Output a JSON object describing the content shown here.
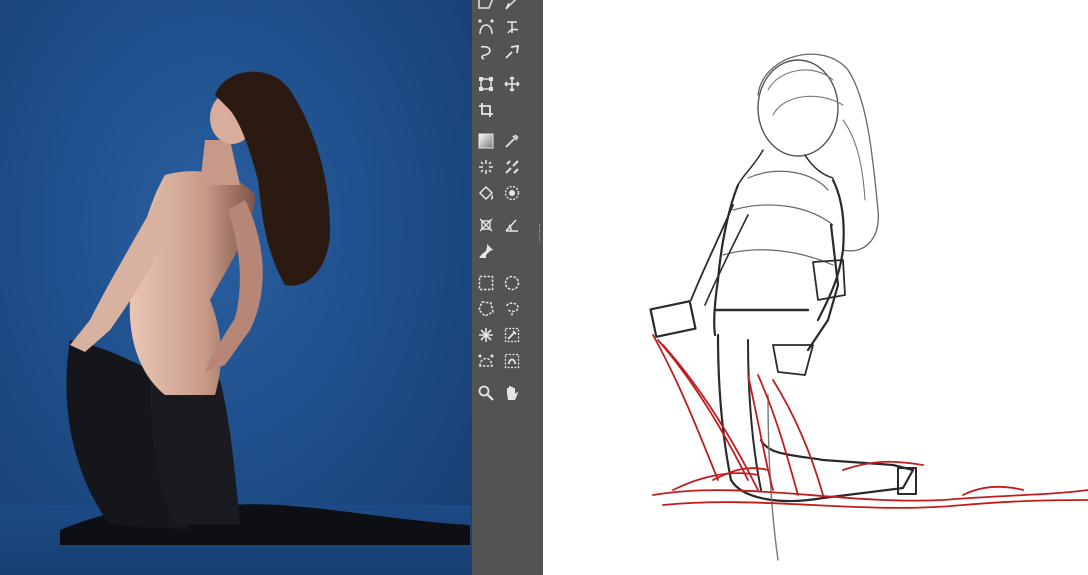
{
  "app": {
    "panels": [
      "reference-photo",
      "toolbox",
      "sketch-canvas"
    ]
  },
  "colors": {
    "backdrop": "#1f4f8c",
    "toolbox_bg": "#535353",
    "tool_icon": "#e6e6e6",
    "sketch_line": "#2a2a2a",
    "sketch_accent": "#c21d1d"
  },
  "toolbox": {
    "tools": [
      {
        "id": "shape-rect",
        "icon": "shape-icon"
      },
      {
        "id": "pen-tool",
        "icon": "pen-icon"
      },
      {
        "id": "bezier-tool",
        "icon": "bezier-icon"
      },
      {
        "id": "text-on-path",
        "icon": "text-path-icon"
      },
      {
        "id": "freehand-path",
        "icon": "freehand-path-icon"
      },
      {
        "id": "dynamic-brush",
        "icon": "dynamic-brush-icon"
      },
      {
        "id": "transform",
        "icon": "transform-icon"
      },
      {
        "id": "move",
        "icon": "move-icon"
      },
      {
        "id": "crop",
        "icon": "crop-icon"
      },
      {
        "id": "gradient",
        "icon": "gradient-icon"
      },
      {
        "id": "color-picker",
        "icon": "eyedropper-icon"
      },
      {
        "id": "smart-patch",
        "icon": "smart-patch-icon"
      },
      {
        "id": "multibrush",
        "icon": "multibrush-icon"
      },
      {
        "id": "fill",
        "icon": "fill-bucket-icon"
      },
      {
        "id": "enclose-fill",
        "icon": "enclose-fill-icon"
      },
      {
        "id": "assistant",
        "icon": "assistant-icon"
      },
      {
        "id": "measure",
        "icon": "measure-icon"
      },
      {
        "id": "reference-pin",
        "icon": "pin-icon"
      },
      {
        "id": "rect-select",
        "icon": "rect-select-icon"
      },
      {
        "id": "ellipse-select",
        "icon": "ellipse-select-icon"
      },
      {
        "id": "polygon-select",
        "icon": "polygon-select-icon"
      },
      {
        "id": "freehand-select",
        "icon": "lasso-icon"
      },
      {
        "id": "contiguous-select",
        "icon": "magic-wand-icon"
      },
      {
        "id": "similar-select",
        "icon": "similar-select-icon"
      },
      {
        "id": "bezier-select",
        "icon": "bezier-select-icon"
      },
      {
        "id": "magnetic-select",
        "icon": "magnetic-select-icon"
      },
      {
        "id": "zoom",
        "icon": "zoom-icon"
      },
      {
        "id": "pan",
        "icon": "hand-icon"
      }
    ]
  }
}
